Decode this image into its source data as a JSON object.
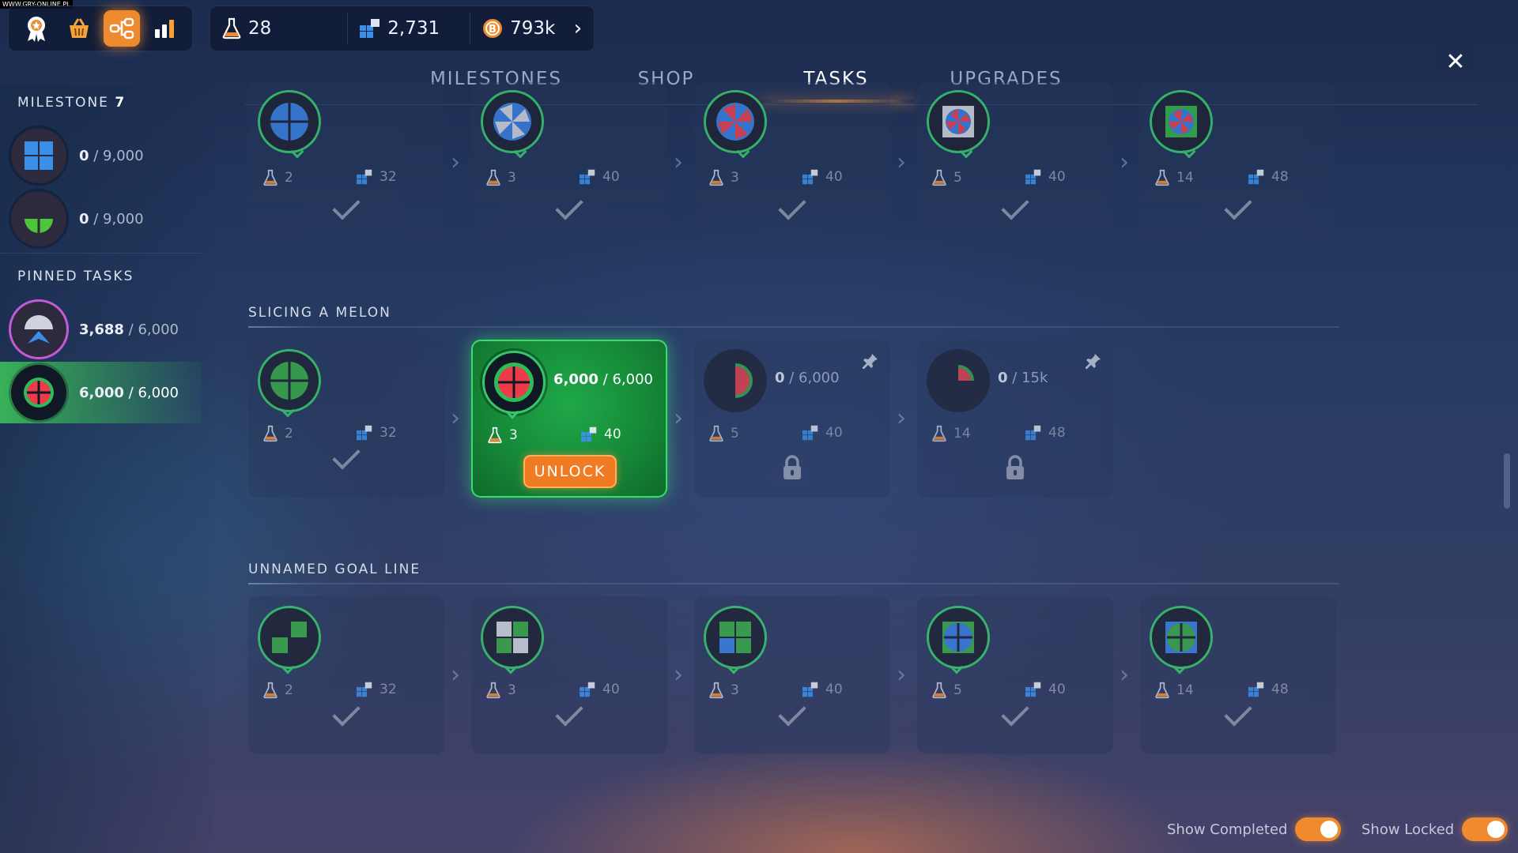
{
  "watermark": "WWW.GRY-ONLINE.PL",
  "resources": {
    "research": "28",
    "parts": "2,731",
    "coins": "793k"
  },
  "tabs": [
    "MILESTONES",
    "SHOP",
    "TASKS",
    "UPGRADES"
  ],
  "active_tab": "TASKS",
  "sidebar": {
    "milestone_label": "MILESTONE",
    "milestone_number": "7",
    "milestones": [
      {
        "done": "0",
        "total": " / 9,000"
      },
      {
        "done": "0",
        "total": " / 9,000"
      }
    ],
    "pinned_title": "PINNED TASKS",
    "pinned": [
      {
        "done": "3,688",
        "total": " / 6,000"
      },
      {
        "done": "6,000",
        "total": " / 6,000"
      }
    ]
  },
  "sections": [
    {
      "title": "",
      "cards": [
        {
          "research": "2",
          "parts": "32",
          "state": "done"
        },
        {
          "research": "3",
          "parts": "40",
          "state": "done"
        },
        {
          "research": "3",
          "parts": "40",
          "state": "done"
        },
        {
          "research": "5",
          "parts": "40",
          "state": "done"
        },
        {
          "research": "14",
          "parts": "48",
          "state": "done"
        }
      ]
    },
    {
      "title": "SLICING A MELON",
      "cards": [
        {
          "research": "2",
          "parts": "32",
          "state": "done"
        },
        {
          "research": "3",
          "parts": "40",
          "state": "active",
          "done": "6,000",
          "total": " / 6,000",
          "button": "UNLOCK"
        },
        {
          "research": "5",
          "parts": "40",
          "state": "locked",
          "done": "0",
          "total": " / 6,000"
        },
        {
          "research": "14",
          "parts": "48",
          "state": "locked",
          "done": "0",
          "total": " / 15k"
        }
      ]
    },
    {
      "title": "UNNAMED GOAL LINE",
      "cards": [
        {
          "research": "2",
          "parts": "32",
          "state": "done"
        },
        {
          "research": "3",
          "parts": "40",
          "state": "done"
        },
        {
          "research": "3",
          "parts": "40",
          "state": "done"
        },
        {
          "research": "5",
          "parts": "40",
          "state": "done"
        },
        {
          "research": "14",
          "parts": "48",
          "state": "done"
        }
      ]
    }
  ],
  "toggles": {
    "show_completed": "Show Completed",
    "show_locked": "Show Locked"
  },
  "colors": {
    "accent": "#f08a2e",
    "success": "#38c66c",
    "panel": "#1b2b4e"
  }
}
